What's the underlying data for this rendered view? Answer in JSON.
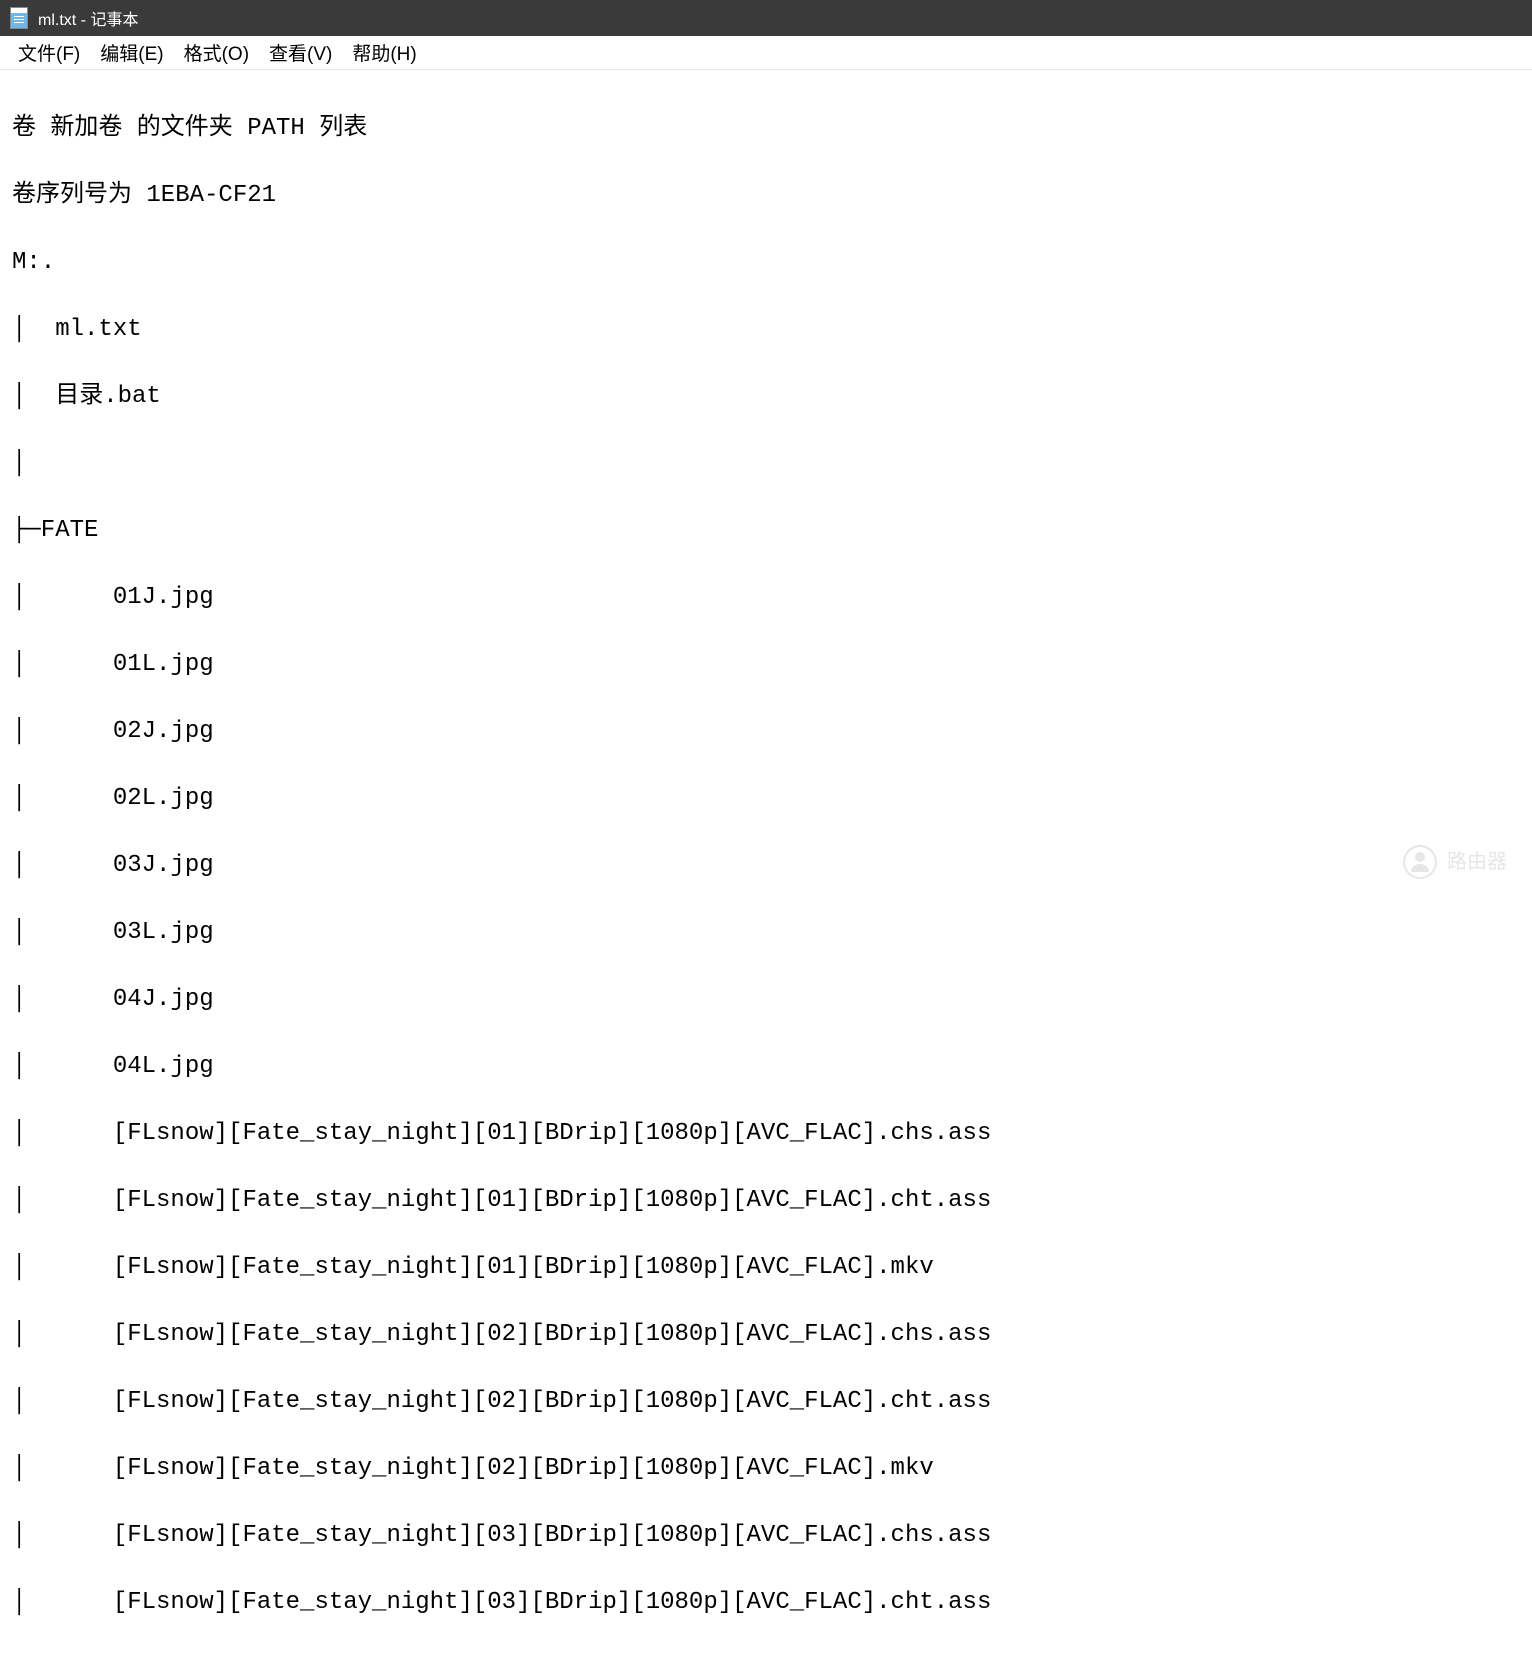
{
  "titlebar": {
    "title": "ml.txt - 记事本"
  },
  "menubar": {
    "items": [
      "文件(F)",
      "编辑(E)",
      "格式(O)",
      "查看(V)",
      "帮助(H)"
    ]
  },
  "content": {
    "lines": [
      "卷 新加卷 的文件夹 PATH 列表",
      "卷序列号为 1EBA-CF21",
      "M:.",
      "│  ml.txt",
      "│  目录.bat",
      "│",
      "├─FATE",
      "│      01J.jpg",
      "│      01L.jpg",
      "│      02J.jpg",
      "│      02L.jpg",
      "│      03J.jpg",
      "│      03L.jpg",
      "│      04J.jpg",
      "│      04L.jpg",
      "│      [FLsnow][Fate_stay_night][01][BDrip][1080p][AVC_FLAC].chs.ass",
      "│      [FLsnow][Fate_stay_night][01][BDrip][1080p][AVC_FLAC].cht.ass",
      "│      [FLsnow][Fate_stay_night][01][BDrip][1080p][AVC_FLAC].mkv",
      "│      [FLsnow][Fate_stay_night][02][BDrip][1080p][AVC_FLAC].chs.ass",
      "│      [FLsnow][Fate_stay_night][02][BDrip][1080p][AVC_FLAC].cht.ass",
      "│      [FLsnow][Fate_stay_night][02][BDrip][1080p][AVC_FLAC].mkv",
      "│      [FLsnow][Fate_stay_night][03][BDrip][1080p][AVC_FLAC].chs.ass",
      "│      [FLsnow][Fate_stay_night][03][BDrip][1080p][AVC_FLAC].cht.ass"
    ]
  },
  "watermark": {
    "text": "路由器"
  }
}
